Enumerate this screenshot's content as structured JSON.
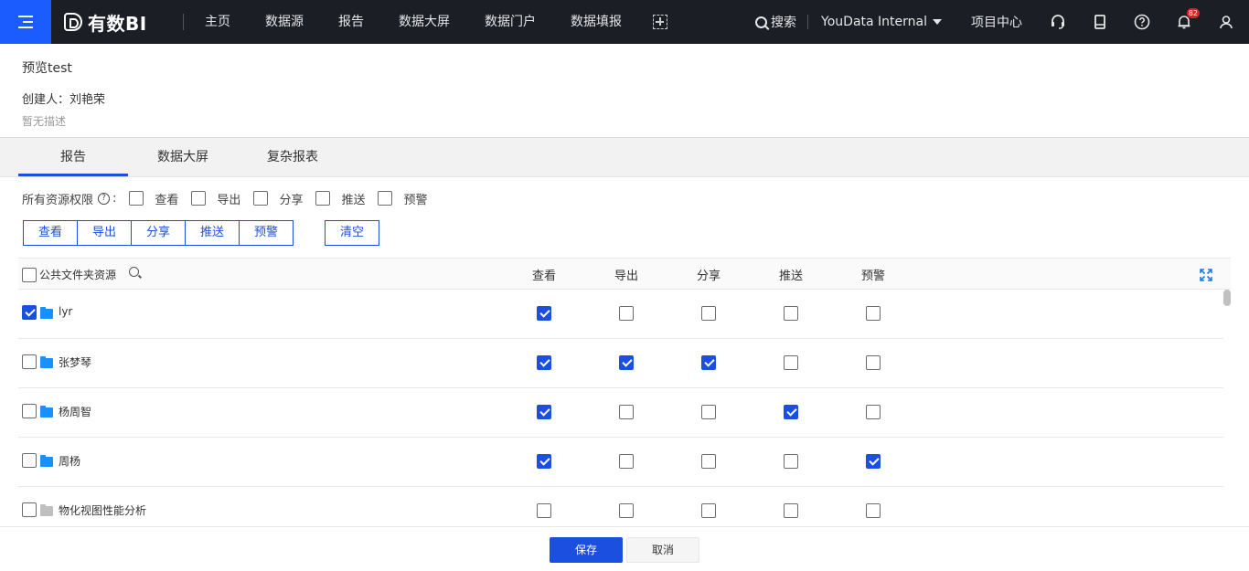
{
  "topbar": {
    "logo_text": "有数BI",
    "nav": [
      "主页",
      "数据源",
      "报告",
      "数据大屏",
      "数据门户",
      "数据填报"
    ],
    "search_label": "搜索",
    "org_name": "YouData Internal",
    "project_center": "项目中心",
    "notification_count": "82",
    "accent_color": "#1a5cff"
  },
  "header": {
    "title": "预览test",
    "creator_label": "创建人：刘艳荣",
    "description": "暂无描述"
  },
  "tabs": [
    {
      "label": "报告",
      "active": true
    },
    {
      "label": "数据大屏",
      "active": false
    },
    {
      "label": "复杂报表",
      "active": false
    }
  ],
  "permissions": {
    "label": "所有资源权限",
    "colon": ":",
    "help_glyph": "?",
    "options": [
      "查看",
      "导出",
      "分享",
      "推送",
      "预警"
    ]
  },
  "bulk_buttons": [
    "查看",
    "导出",
    "分享",
    "推送",
    "预警"
  ],
  "clear_label": "清空",
  "table": {
    "folder_header": "公共文件夹资源",
    "columns": [
      "查看",
      "导出",
      "分享",
      "推送",
      "预警"
    ],
    "rows": [
      {
        "name": "lyr",
        "selected": true,
        "folder_color": "blue",
        "perms": [
          true,
          false,
          false,
          false,
          false
        ]
      },
      {
        "name": "张梦琴",
        "selected": false,
        "folder_color": "blue",
        "perms": [
          true,
          true,
          true,
          false,
          false
        ]
      },
      {
        "name": "杨周智",
        "selected": false,
        "folder_color": "blue",
        "perms": [
          true,
          false,
          false,
          true,
          false
        ]
      },
      {
        "name": "周杨",
        "selected": false,
        "folder_color": "blue",
        "perms": [
          true,
          false,
          false,
          false,
          true
        ]
      },
      {
        "name": "物化视图性能分析",
        "selected": false,
        "folder_color": "gray",
        "perms": [
          false,
          false,
          false,
          false,
          false
        ]
      }
    ]
  },
  "footer": {
    "save_label": "保存",
    "cancel_label": "取消"
  }
}
